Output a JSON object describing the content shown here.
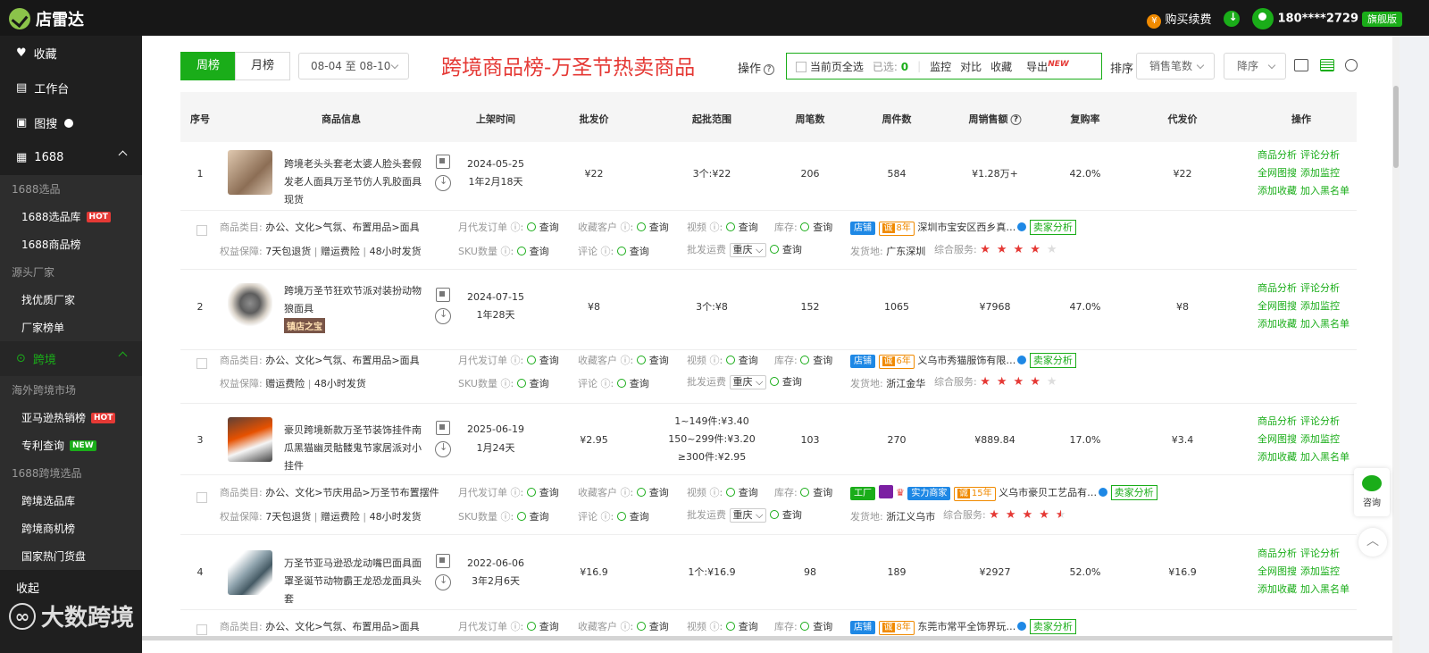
{
  "app": {
    "name": "店雷达"
  },
  "topbar": {
    "buy": "购买续费",
    "phone": "180****2729",
    "plan": "旗舰版"
  },
  "sidebar": {
    "fav": "收藏",
    "workbench": "工作台",
    "imgsearch": "图搜",
    "s1688": "1688",
    "g1688select": "1688选品",
    "lib1688": "1688选品库",
    "rank1688": "1688商品榜",
    "gsource": "源头厂家",
    "findfactory": "找优质厂家",
    "factoryrank": "厂家榜单",
    "crossborder": "跨境",
    "goverseas": "海外跨境市场",
    "amazon": "亚马逊热销榜",
    "patent": "专利查询",
    "g1688cross": "1688跨境选品",
    "crosslib": "跨境选品库",
    "crossopp": "跨境商机榜",
    "hotgoods": "国家热门货盘",
    "collapse": "收起",
    "hot": "HOT",
    "new": "NEW"
  },
  "watermark": "大数跨境",
  "toolbar": {
    "week": "周榜",
    "month": "月榜",
    "date": "08-04 至 08-10",
    "title": "跨境商品榜-万圣节热卖商品",
    "op": "操作",
    "selectall": "当前页全选",
    "selected": "已选:",
    "selected_count": "0",
    "monitor": "监控",
    "compare": "对比",
    "collect": "收藏",
    "export": "导出",
    "new": "NEW",
    "sort": "排序",
    "sortby": "销售笔数",
    "order": "降序"
  },
  "columns": [
    "序号",
    "商品信息",
    "上架时间",
    "批发价",
    "起批范围",
    "周笔数",
    "周件数",
    "周销售额",
    "复购率",
    "代发价",
    "操作"
  ],
  "actions": {
    "a1": "商品分析",
    "a2": "评论分析",
    "a3": "全网图搜",
    "a4": "添加监控",
    "a5": "添加收藏",
    "a6": "加入黑名单"
  },
  "labels": {
    "cat": "商品类目:",
    "rights": "权益保障:",
    "monthly": "月代发订单",
    "fav": "收藏客户",
    "video": "视频",
    "stock": "库存:",
    "sku": "SKU数量",
    "review": "评论",
    "ship": "批发运费",
    "query": "查询",
    "origin": "发货地:",
    "service": "综合服务:",
    "seller": "卖家分析",
    "shop": "店铺",
    "factory": "工厂",
    "city": "重庆"
  },
  "rows": [
    {
      "no": "1",
      "name": "跨境老头头套老太婆人脸头套假发老人面具万圣节仿人乳胶面具现货",
      "date": "2024-05-25",
      "age": "1年2月18天",
      "price": "¥22",
      "range": "3个:¥22",
      "orders": "206",
      "pieces": "584",
      "sales": "¥1.28万+",
      "repurchase": "42.0%",
      "dropship": "¥22",
      "cat": "办公、文化>气氛、布置用品>面具",
      "rights": [
        "7天包退货",
        "赠运费险",
        "48小时发货"
      ],
      "years": "8年",
      "shop": "深圳市宝安区西乡真…",
      "origin": "广东深圳",
      "stars": 4
    },
    {
      "no": "2",
      "name": "跨境万圣节狂欢节派对装扮动物狼面具",
      "badge": "镇店之宝",
      "date": "2024-07-15",
      "age": "1年28天",
      "price": "¥8",
      "range": "3个:¥8",
      "orders": "152",
      "pieces": "1065",
      "sales": "¥7968",
      "repurchase": "47.0%",
      "dropship": "¥8",
      "cat": "办公、文化>气氛、布置用品>面具",
      "rights": [
        "赠运费险",
        "48小时发货"
      ],
      "years": "6年",
      "shop": "义乌市秀猫服饰有限…",
      "origin": "浙江金华",
      "stars": 4
    },
    {
      "no": "3",
      "name": "豪贝跨境新款万圣节装饰挂件南瓜黑猫幽灵骷髅鬼节家居派对小挂件",
      "date": "2025-06-19",
      "age": "1月24天",
      "price": "¥2.95",
      "range_lines": [
        "1~149件:¥3.40",
        "150~299件:¥3.20",
        "≥300件:¥2.95"
      ],
      "orders": "103",
      "pieces": "270",
      "sales": "¥889.84",
      "repurchase": "17.0%",
      "dropship": "¥3.4",
      "cat": "办公、文化>节庆用品>万圣节布置摆件",
      "rights": [
        "7天包退货",
        "赠运费险",
        "48小时发货"
      ],
      "years": "15年",
      "shop": "义乌市豪贝工艺品有…",
      "origin": "浙江义乌市",
      "stars": 4.5,
      "reliable": "实力商家"
    },
    {
      "no": "4",
      "name": "万圣节亚马逊恐龙动嘴巴面具面罩圣诞节动物霸王龙恐龙面具头套",
      "date": "2022-06-06",
      "age": "3年2月6天",
      "price": "¥16.9",
      "range": "1个:¥16.9",
      "orders": "98",
      "pieces": "189",
      "sales": "¥2927",
      "repurchase": "52.0%",
      "dropship": "¥16.9",
      "cat": "办公、文化>气氛、布置用品>面具",
      "years": "8年",
      "shop": "东莞市常平全饰界玩…"
    }
  ],
  "float": {
    "consult": "咨询"
  }
}
